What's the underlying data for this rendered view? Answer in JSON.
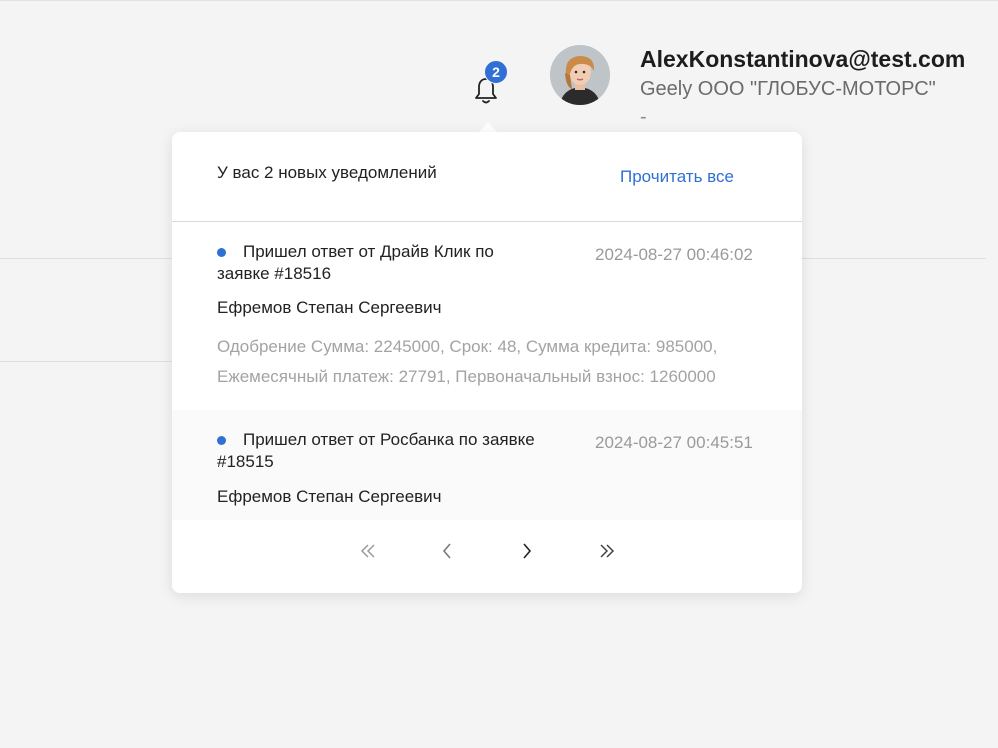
{
  "header": {
    "notifications_count": "2",
    "user": {
      "email": "AlexKonstantinova@test.com",
      "company": "Geely ООО \"ГЛОБУС-МОТОРС\"",
      "extra": "-"
    }
  },
  "notifications_panel": {
    "title": "У вас 2 новых уведомлений",
    "read_all_label": "Прочитать все",
    "items": [
      {
        "title": "Пришел ответ от Драйв Клик по заявке #18516",
        "time": "2024-08-27 00:46:02",
        "author": "Ефремов Степан Сергеевич",
        "body": "Одобрение Сумма: 2245000, Срок: 48, Сумма кредита: 985000, Ежемесячный платеж: 27791, Первоначальный взнос: 1260000"
      },
      {
        "title": "Пришел ответ от Росбанка по заявке #18515",
        "time": "2024-08-27 00:45:51",
        "author": "Ефремов Степан Сергеевич",
        "body": ""
      }
    ],
    "pagination": {
      "icons": [
        "double-chevron-left-icon",
        "chevron-left-icon",
        "chevron-right-icon",
        "double-chevron-right-icon"
      ]
    }
  },
  "colors": {
    "accent": "#2f6fd6",
    "background": "#f4f4f4",
    "muted_text": "#a3a3a3"
  }
}
